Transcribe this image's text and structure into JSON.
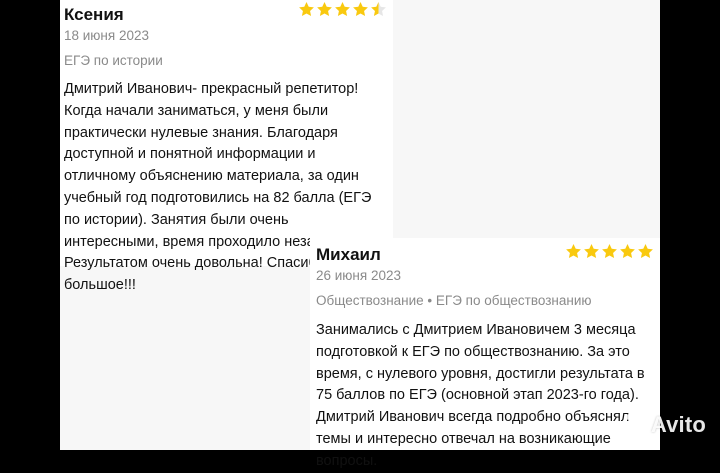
{
  "reviews": [
    {
      "author": "Ксения",
      "date": "18 июня 2023",
      "tags": "ЕГЭ по истории",
      "rating": 4.5,
      "text": "Дмитрий Иванович- прекрасный репетитор! Когда начали заниматься, у меня были практически нулевые знания. Благодаря доступной и понятной информации и отличному объяснению материала, за один учебный год подготовились на 82 балла (ЕГЭ по истории). Занятия были очень интересными, время проходило незаметно. Результатом очень довольна! Спасибо большое!!!"
    },
    {
      "author": "Михаил",
      "date": "26 июня 2023",
      "tags": "Обществознание • ЕГЭ по обществознанию",
      "rating": 5,
      "text": "Занимались с Дмитрием Ивановичем 3 месяца подготовкой к ЕГЭ по обществознанию. За это время, с нулевого уровня, достигли результата в 75 баллов по ЕГЭ (основной этап 2023-го года). Дмитрий Иванович всегда подробно объяснял темы и интересно отвечал на возникающие вопросы."
    }
  ],
  "watermark": {
    "label": "Avito"
  },
  "colors": {
    "star": "#f9c90f",
    "muted_text": "#8a8a8a",
    "main_text": "#111111"
  }
}
